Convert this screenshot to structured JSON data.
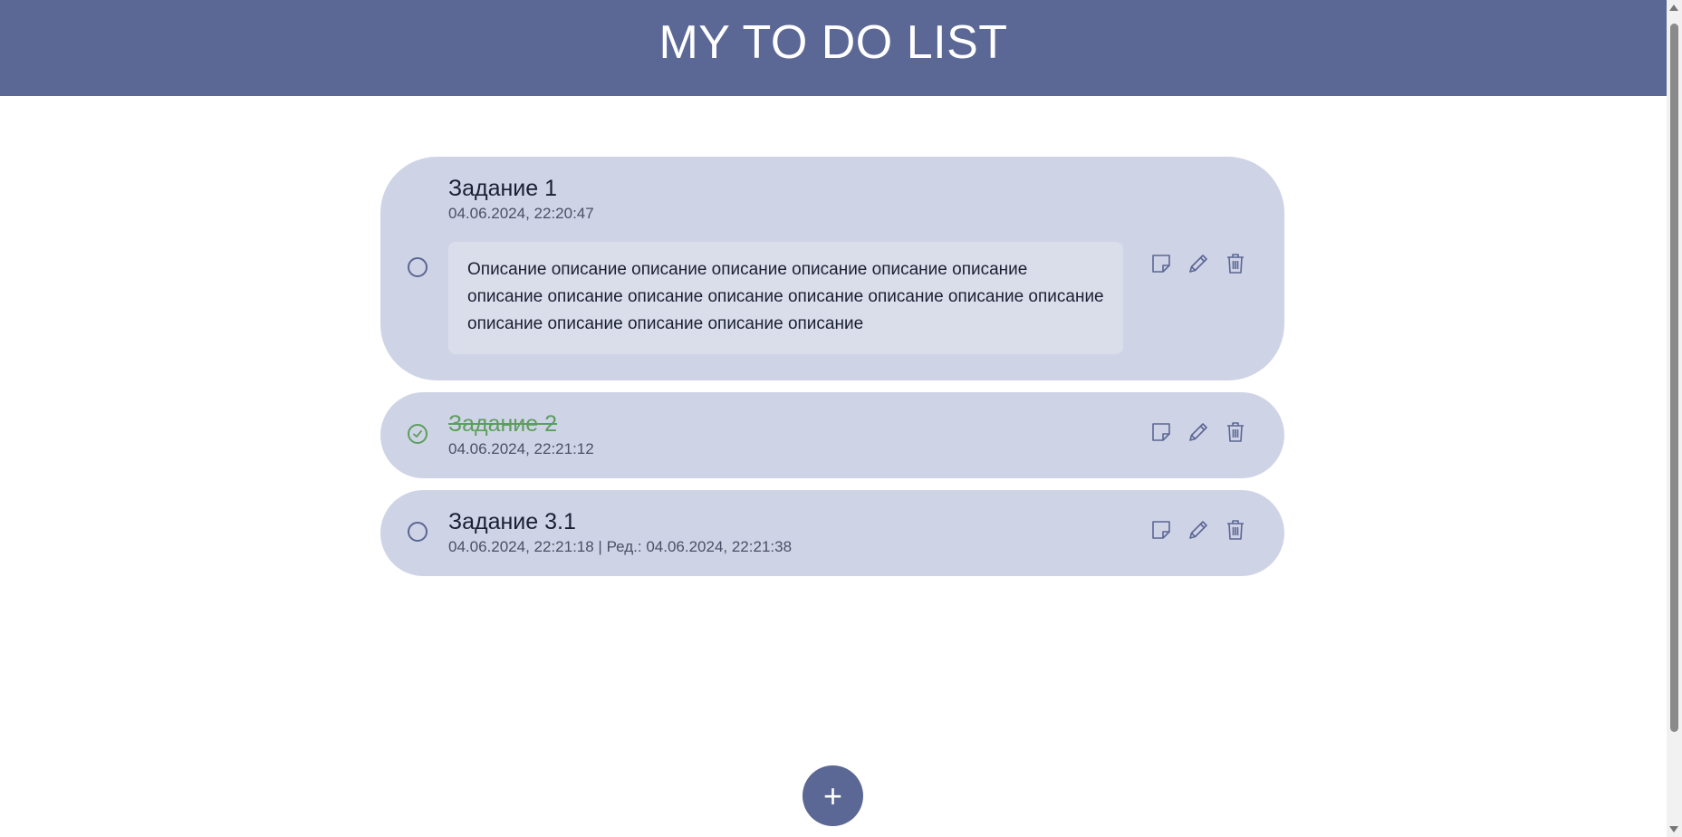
{
  "header": {
    "title": "MY TO DO LIST"
  },
  "tasks": [
    {
      "title": "Задание 1",
      "date": "04.06.2024, 22:20:47",
      "description": "Описание описание описание описание описание описание описание описание описание описание описание описание описание описание описание описание описание описание описание описание",
      "done": false
    },
    {
      "title": "Задание 2",
      "date": "04.06.2024, 22:21:12",
      "done": true
    },
    {
      "title": "Задание 3.1",
      "date": "04.06.2024, 22:21:18  | Ред.: 04.06.2024, 22:21:38",
      "done": false
    }
  ],
  "actions": {
    "note_icon": "note-icon",
    "edit_icon": "pencil-icon",
    "delete_icon": "trash-icon"
  },
  "add_button": {
    "label": "+"
  },
  "colors": {
    "header": "#5b6794",
    "card": "#cfd3e6",
    "description_bg": "#dadeeb",
    "done": "#5c9e5e",
    "icon": "#5b6794"
  }
}
